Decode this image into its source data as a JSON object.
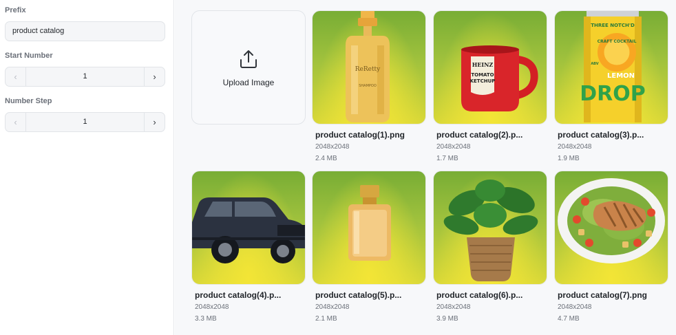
{
  "sidebar": {
    "prefix": {
      "label": "Prefix",
      "value": "product catalog"
    },
    "start_number": {
      "label": "Start Number",
      "value": "1",
      "decrement_icon": "chevron-left-icon",
      "increment_icon": "chevron-right-icon"
    },
    "number_step": {
      "label": "Number Step",
      "value": "1",
      "decrement_icon": "chevron-left-icon",
      "increment_icon": "chevron-right-icon"
    }
  },
  "upload": {
    "label": "Upload Image",
    "icon": "upload-icon"
  },
  "images": [
    {
      "name": "product catalog(1).png",
      "dims": "2048x2048",
      "size": "2.4 MB",
      "subject": "soap-bottle"
    },
    {
      "name": "product catalog(2).p...",
      "dims": "2048x2048",
      "size": "1.7 MB",
      "subject": "ketchup-mug"
    },
    {
      "name": "product catalog(3).p...",
      "dims": "2048x2048",
      "size": "1.9 MB",
      "subject": "drink-can"
    },
    {
      "name": "product catalog(4).p...",
      "dims": "2048x2048",
      "size": "3.3 MB",
      "subject": "suv"
    },
    {
      "name": "product catalog(5).p...",
      "dims": "2048x2048",
      "size": "2.1 MB",
      "subject": "perfume-bottle"
    },
    {
      "name": "product catalog(6).p...",
      "dims": "2048x2048",
      "size": "3.9 MB",
      "subject": "potted-plant"
    },
    {
      "name": "product catalog(7).png",
      "dims": "2048x2048",
      "size": "4.7 MB",
      "subject": "salad-plate"
    }
  ],
  "thumbnail_text": {
    "soap_brand": "ReRetty",
    "soap_type": "SHAMPOO",
    "mug_brand": "HEINZ",
    "mug_line1": "TOMATO",
    "mug_line2": "KETCHUP",
    "can_brand": "THREE NOTCH'D",
    "can_line1": "CRAFT COCKTAIL",
    "can_line2": "LEMON",
    "can_line3": "DROP",
    "can_badge": "ABV"
  },
  "colors": {
    "thumb_green": "#78ad35",
    "thumb_yellow": "#f3e536",
    "border": "#e1e4e8"
  }
}
